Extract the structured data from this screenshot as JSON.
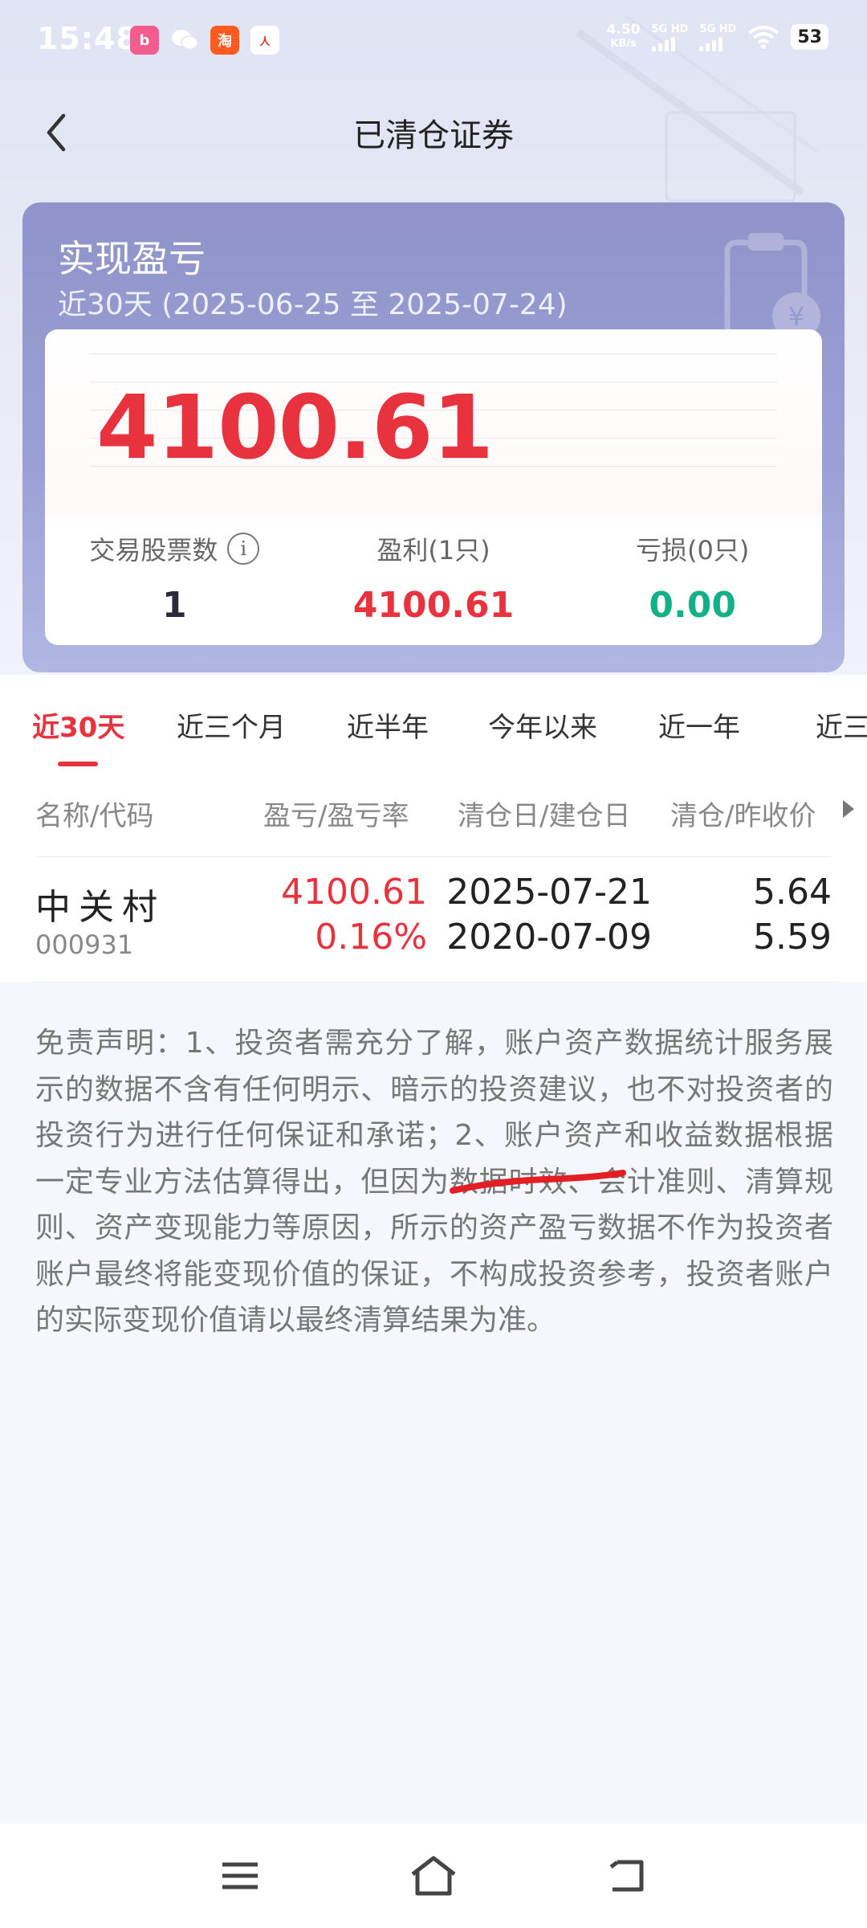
{
  "status_bar": {
    "time": "15:48",
    "net_speed_value": "4.50",
    "net_speed_unit": "KB/s",
    "sim1_label": "5G HD",
    "sim2_label": "5G HD",
    "battery": "53",
    "app_icons": [
      "bilibili-icon",
      "wechat-icon",
      "taobao-icon",
      "people-daily-icon"
    ]
  },
  "header": {
    "title": "已清仓证券"
  },
  "summary": {
    "title": "实现盈亏",
    "period": "近30天 (2025-06-25 至 2025-07-24)",
    "total": "4100.61",
    "stats": [
      {
        "label": "交易股票数",
        "value": "1"
      },
      {
        "label": "盈利(1只)",
        "value": "4100.61"
      },
      {
        "label": "亏损(0只)",
        "value": "0.00"
      }
    ]
  },
  "tabs": [
    "近30天",
    "近三个月",
    "近半年",
    "今年以来",
    "近一年",
    "近三"
  ],
  "table": {
    "headers": [
      "名称/代码",
      "盈亏/盈亏率",
      "清仓日/建仓日",
      "清仓/昨收价"
    ],
    "rows": [
      {
        "name": "中关村",
        "code": "000931",
        "profit": "4100.61",
        "profit_rate": "0.16%",
        "clear_date": "2025-07-21",
        "open_date": "2020-07-09",
        "clear_price": "5.64",
        "prev_close": "5.59"
      }
    ]
  },
  "disclaimer": "免责声明：1、投资者需充分了解，账户资产数据统计服务展示的数据不含有任何明示、暗示的投资建议，也不对投资者的投资行为进行任何保证和承诺；2、账户资产和收益数据根据一定专业方法估算得出，但因为数据时效、会计准则、清算规则、资产变现能力等原因，所示的资产盈亏数据不作为投资者账户最终将能变现价值的保证，不构成投资参考，投资者账户的实际变现价值请以最终清算结果为准。",
  "colors": {
    "accent_red": "#e8323e",
    "loss_green": "#14b08a",
    "card_purple": "#9aa0d4"
  }
}
